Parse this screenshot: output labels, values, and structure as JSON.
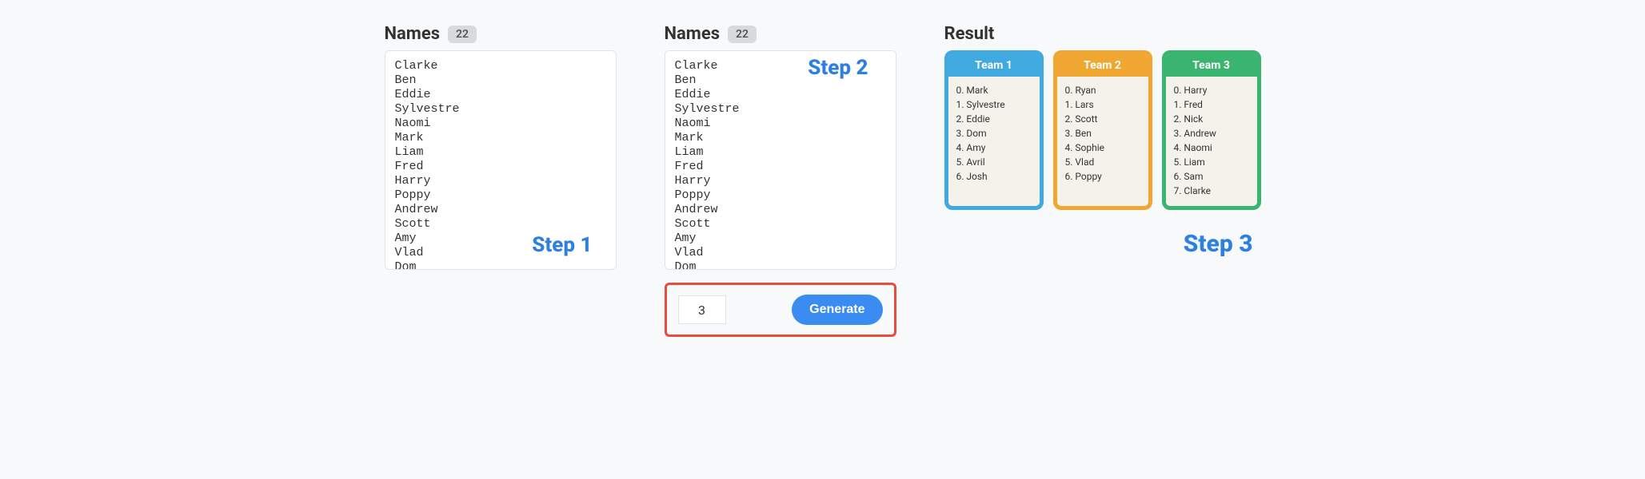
{
  "panel1": {
    "title": "Names",
    "count": "22",
    "names": "Clarke\nBen\nEddie\nSylvestre\nNaomi\nMark\nLiam\nFred\nHarry\nPoppy\nAndrew\nScott\nAmy\nVlad\nDom\nRyan",
    "step_label": "Step 1"
  },
  "panel2": {
    "title": "Names",
    "count": "22",
    "names": "Clarke\nBen\nEddie\nSylvestre\nNaomi\nMark\nLiam\nFred\nHarry\nPoppy\nAndrew\nScott\nAmy\nVlad\nDom\nRyan",
    "step_label": "Step 2",
    "num_value": "3",
    "generate_label": "Generate"
  },
  "result": {
    "title": "Result",
    "step_label": "Step 3",
    "teams": [
      {
        "name": "Team 1",
        "members": [
          "0. Mark",
          "1. Sylvestre",
          "2. Eddie",
          "3. Dom",
          "4. Amy",
          "5. Avril",
          "6. Josh"
        ]
      },
      {
        "name": "Team 2",
        "members": [
          "0. Ryan",
          "1. Lars",
          "2. Scott",
          "3. Ben",
          "4. Sophie",
          "5. Vlad",
          "6. Poppy"
        ]
      },
      {
        "name": "Team 3",
        "members": [
          "0. Harry",
          "1. Fred",
          "2. Nick",
          "3. Andrew",
          "4. Naomi",
          "5. Liam",
          "6. Sam",
          "7. Clarke"
        ]
      }
    ]
  }
}
